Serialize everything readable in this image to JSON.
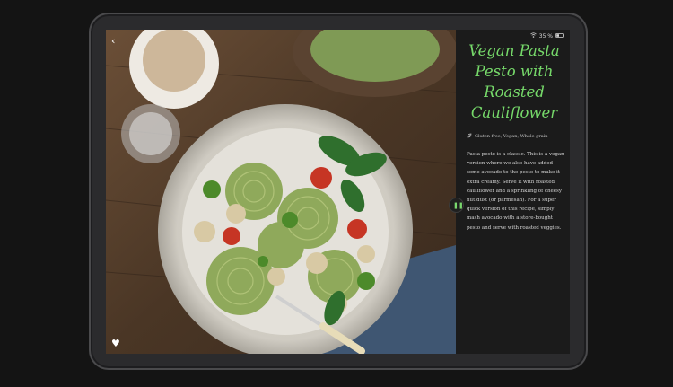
{
  "status": {
    "battery_text": "35 %",
    "wifi_icon": "wifi-icon",
    "battery_icon": "battery-icon"
  },
  "recipe": {
    "title": "Vegan Pasta Pesto with Roasted Cauliflower",
    "tags": "Gluten free, Vegan, Whole grain",
    "description": "Pasta pesto is a classic. This is a vegan version where we also have added some avocado to the pesto to make it extra creamy. Serve it with roasted cauliflower and a sprinkling of cheesy nut dust (or parmesan). For a super quick version of this recipe, simply mash avocado with a store-bought pesto and serve with roasted veggies."
  },
  "icons": {
    "back": "back-chevron-icon",
    "favorite": "heart-icon",
    "tag": "leaf-icon",
    "divider_handle": "pause-handle-icon"
  },
  "colors": {
    "accent": "#76d96a",
    "panel_background": "#1b1b1b",
    "page_background": "#141414"
  }
}
